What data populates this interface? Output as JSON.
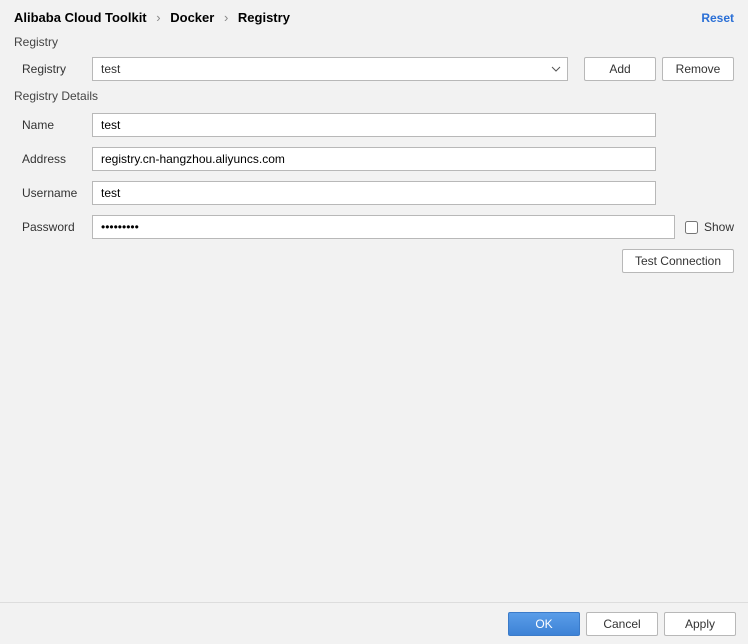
{
  "breadcrumb": {
    "item1": "Alibaba Cloud Toolkit",
    "item2": "Docker",
    "item3": "Registry"
  },
  "reset": "Reset",
  "section_registry": "Registry",
  "registry_label": "Registry",
  "registry_selected": "test",
  "add_button": "Add",
  "remove_button": "Remove",
  "section_details": "Registry Details",
  "details": {
    "name_label": "Name",
    "name_value": "test",
    "address_label": "Address",
    "address_value": "registry.cn-hangzhou.aliyuncs.com",
    "username_label": "Username",
    "username_value": "test",
    "password_label": "Password",
    "password_value": "•••••••••",
    "show_label": "Show",
    "test_connection": "Test Connection"
  },
  "footer": {
    "ok": "OK",
    "cancel": "Cancel",
    "apply": "Apply"
  }
}
